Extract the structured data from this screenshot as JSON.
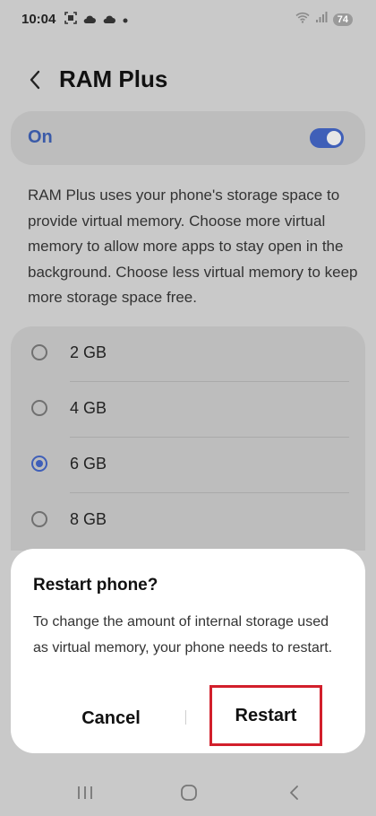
{
  "status_bar": {
    "time": "10:04",
    "battery": "74",
    "icons_left": [
      "screenshot-icon",
      "cloud-icon",
      "cloud-icon",
      "dot-icon"
    ],
    "icons_right": [
      "wifi-icon",
      "signal-icon",
      "battery-icon"
    ]
  },
  "header": {
    "title": "RAM Plus"
  },
  "toggle": {
    "label": "On",
    "state": "on"
  },
  "description": "RAM Plus uses your phone's storage space to provide virtual memory. Choose more virtual memory to allow more apps to stay open in the background. Choose less virtual memory to keep more storage space free.",
  "options": [
    {
      "label": "2 GB",
      "selected": false
    },
    {
      "label": "4 GB",
      "selected": false
    },
    {
      "label": "6 GB",
      "selected": true
    },
    {
      "label": "8 GB",
      "selected": false
    }
  ],
  "dialog": {
    "title": "Restart phone?",
    "body": "To change the amount of internal storage used as virtual memory, your phone needs to restart.",
    "cancel_label": "Cancel",
    "restart_label": "Restart"
  },
  "navigation": {
    "buttons": [
      "recents-icon",
      "home-icon",
      "back-icon"
    ]
  },
  "colors": {
    "accent": "#3f5fb8",
    "highlight": "#d21f2b",
    "scrim": "#c9c9c9"
  }
}
